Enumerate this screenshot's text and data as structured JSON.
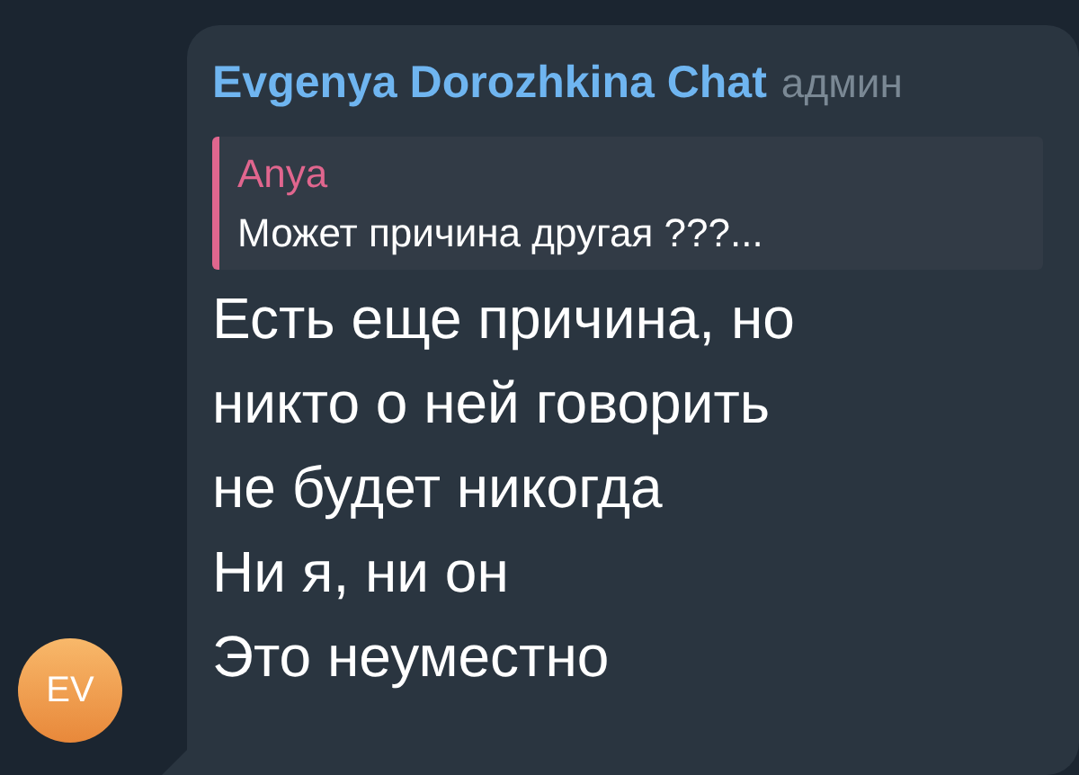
{
  "message": {
    "sender": "Evgenya Dorozhkina Chat",
    "sender_role": "админ",
    "reply": {
      "author": "Anya",
      "text": "Может причина другая ???..."
    },
    "lines": [
      "Есть еще причина, но",
      "никто о ней говорить",
      "не будет никогда",
      "Ни я, ни он",
      "Это неуместно"
    ]
  },
  "avatar": {
    "initials": "EV"
  }
}
